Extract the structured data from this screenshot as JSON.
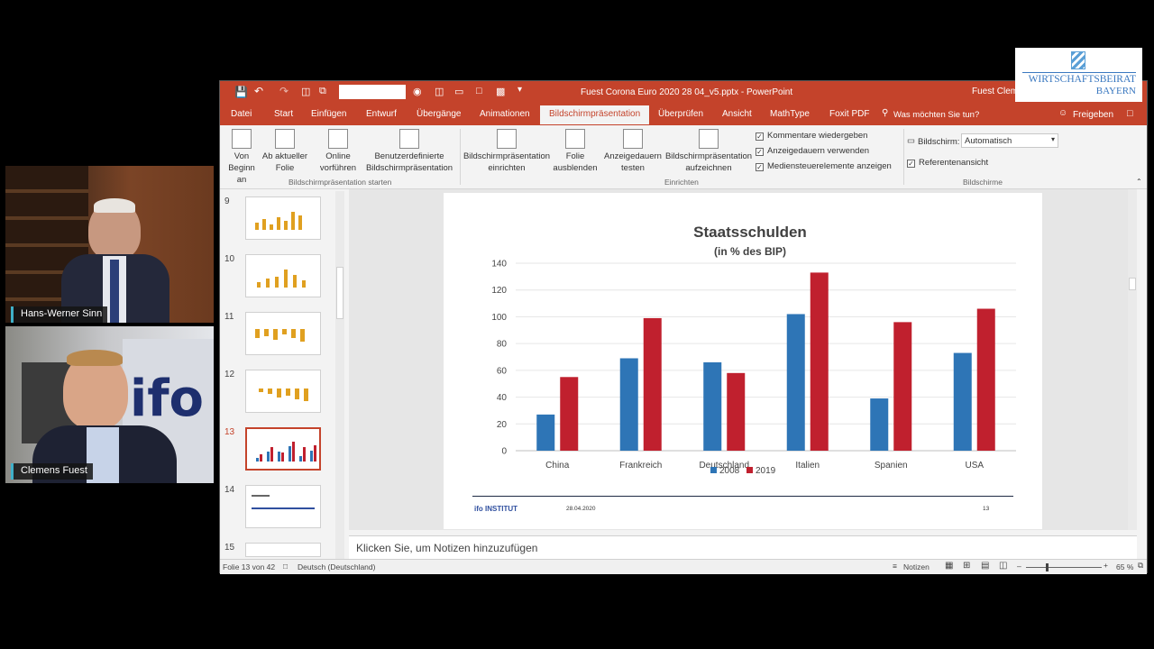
{
  "participants": [
    {
      "name": "Hans-Werner Sinn"
    },
    {
      "name": "Clemens Fuest"
    }
  ],
  "window": {
    "title": "Fuest Corona Euro 2020 28 04_v5.pptx  -  PowerPoint",
    "user": "Fuest Clem"
  },
  "logo": {
    "line1": "WIRTSCHAFTSBEIRAT",
    "line2": "BAYERN"
  },
  "tabs": [
    "Datei",
    "Start",
    "Einfügen",
    "Entwurf",
    "Übergänge",
    "Animationen",
    "Bildschirmpräsentation",
    "Überprüfen",
    "Ansicht",
    "MathType",
    "Foxit PDF"
  ],
  "tell_me": "Was möchten Sie tun?",
  "share": "Freigeben",
  "ribbon": {
    "von_beginn": [
      "Von",
      "Beginn an"
    ],
    "ab_aktueller": [
      "Ab aktueller",
      "Folie"
    ],
    "online": [
      "Online",
      "vorführen"
    ],
    "benutzer": [
      "Benutzerdefinierte",
      "Bildschirmpräsentation"
    ],
    "group1": "Bildschirmpräsentation starten",
    "einrichten": [
      "Bildschirmpräsentation",
      "einrichten"
    ],
    "ausblenden": [
      "Folie",
      "ausblenden"
    ],
    "anzeigedauern": [
      "Anzeigedauern",
      "testen"
    ],
    "aufzeichnen": [
      "Bildschirmpräsentation",
      "aufzeichnen"
    ],
    "group2": "Einrichten",
    "checks": [
      "Kommentare wiedergeben",
      "Anzeigedauern verwenden",
      "Mediensteuerelemente anzeigen"
    ],
    "bildschirm_label": "Bildschirm:",
    "bildschirm_value": "Automatisch",
    "referent": "Referentenansicht",
    "group3": "Bildschirme"
  },
  "thumbnails": [
    "9",
    "10",
    "11",
    "12",
    "13",
    "14",
    "15"
  ],
  "selected_thumbnail": "13",
  "slide": {
    "title": "Staatsschulden",
    "subtitle": "(in % des BIP)",
    "footer_logo": "ifo INSTITUT",
    "footer_date": "28.04.2020",
    "footer_page": "13"
  },
  "chart_data": {
    "type": "bar",
    "title": "Staatsschulden",
    "subtitle": "(in % des BIP)",
    "categories": [
      "China",
      "Frankreich",
      "Deutschland",
      "Italien",
      "Spanien",
      "USA"
    ],
    "series": [
      {
        "name": "2008",
        "values": [
          27,
          69,
          66,
          102,
          39,
          73
        ],
        "color": "#2e75b6"
      },
      {
        "name": "2019",
        "values": [
          55,
          99,
          58,
          133,
          96,
          106
        ],
        "color": "#c0202e"
      }
    ],
    "ylim": [
      0,
      140
    ],
    "yticks": [
      "0",
      "20",
      "40",
      "60",
      "80",
      "100",
      "120",
      "140"
    ],
    "grid": true,
    "legend": "bottom"
  },
  "notes": "Klicken Sie, um Notizen hinzuzufügen",
  "status": {
    "slide": "Folie 13 von 42",
    "language": "Deutsch (Deutschland)",
    "notes": "Notizen",
    "zoom": "65 %"
  }
}
